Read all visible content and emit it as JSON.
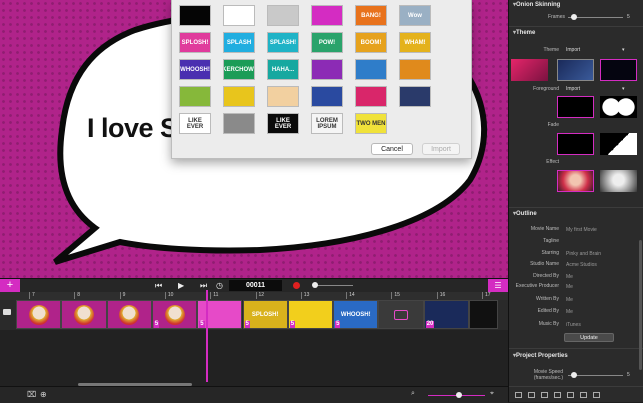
{
  "canvas": {
    "text": "I love S"
  },
  "dialog": {
    "tiles": [
      [
        {
          "bg": "#050505",
          "label": ""
        },
        {
          "bg": "#ffffff",
          "label": ""
        },
        {
          "bg": "#c9c9c9",
          "label": ""
        },
        {
          "bg": "#d42cc2",
          "label": ""
        },
        {
          "bg": "#e8721c",
          "label": "BANG!"
        },
        {
          "bg": "#9ab0c4",
          "label": "Wow"
        }
      ],
      [
        {
          "bg": "#e03b9c",
          "label": "SPLOSH!"
        },
        {
          "bg": "#21aee0",
          "label": "SPLASH"
        },
        {
          "bg": "#1fb3c6",
          "label": "SPLASH!"
        },
        {
          "bg": "#2aa36b",
          "label": "POW!"
        },
        {
          "bg": "#e6a21d",
          "label": "BOOM!"
        },
        {
          "bg": "#e4b21c",
          "label": "WHAM!"
        }
      ],
      [
        {
          "bg": "#4a2fb0",
          "label": "WHOOSH!"
        },
        {
          "bg": "#1b9c57",
          "label": "KERCHOW!"
        },
        {
          "bg": "#17a8a0",
          "label": "HAHA..."
        },
        {
          "bg": "#8c2bb5",
          "label": ""
        },
        {
          "bg": "#2f7dc9",
          "label": ""
        },
        {
          "bg": "#e08a1c",
          "label": ""
        }
      ],
      [
        {
          "bg": "#86b83a",
          "label": ""
        },
        {
          "bg": "#e8c51c",
          "label": ""
        },
        {
          "bg": "#f2d0a0",
          "label": ""
        },
        {
          "bg": "#2a4aa0",
          "label": ""
        },
        {
          "bg": "#d9266a",
          "label": ""
        },
        {
          "bg": "#2a3a6a",
          "label": ""
        }
      ],
      [
        {
          "bg": "#ffffff",
          "label": "LIKE EVER"
        },
        {
          "bg": "#8a8a8a",
          "label": ""
        },
        {
          "bg": "#0a0a0a",
          "label": "LIKE EVER"
        },
        {
          "bg": "#f5f5f5",
          "label": "LOREM IPSUM"
        },
        {
          "bg": "#f0e23a",
          "label": "TWO MEN"
        }
      ]
    ],
    "cancel_label": "Cancel",
    "import_label": "Import"
  },
  "transport": {
    "frame_counter": "00011",
    "add_label": "+"
  },
  "timeline": {
    "ruler_ticks": [
      "7",
      "8",
      "9",
      "10",
      "11",
      "12",
      "13",
      "14",
      "15",
      "16",
      "17"
    ],
    "clips": [
      {
        "type": "photo",
        "bg": "#b0238a",
        "label": "",
        "num": ""
      },
      {
        "type": "photo",
        "bg": "#b0238a",
        "label": "",
        "num": ""
      },
      {
        "type": "photo",
        "bg": "#b0238a",
        "label": "",
        "num": ""
      },
      {
        "type": "photo",
        "bg": "#b0238a",
        "label": "",
        "num": "5"
      },
      {
        "type": "title",
        "bg": "#e64ac8",
        "label": "",
        "num": "5"
      },
      {
        "type": "title",
        "bg": "#d9b21c",
        "label": "SPLOSH!",
        "num": "5"
      },
      {
        "type": "title",
        "bg": "#f2cf1c",
        "label": "",
        "num": "5"
      },
      {
        "type": "title",
        "bg": "#2a6ac4",
        "label": "WHOOSH!",
        "num": "5"
      },
      {
        "type": "camera",
        "bg": "#3a3a3a",
        "label": "",
        "num": ""
      },
      {
        "type": "title",
        "bg": "#1a2a5a",
        "label": "",
        "num": "20"
      },
      {
        "type": "empty",
        "bg": "#111111",
        "label": "",
        "num": ""
      }
    ]
  },
  "inspector": {
    "onion": {
      "title": "Onion Skinning",
      "frames_label": "Frames",
      "frames_value": "5",
      "frames_fraction": 0.1
    },
    "theme": {
      "title": "Theme",
      "theme_label": "Theme",
      "theme_value": "Import",
      "foreground_label": "Foreground",
      "foreground_value": "Import",
      "fade_label": "Fade",
      "effect_label": "Effect"
    },
    "outline": {
      "title": "Outline",
      "rows": [
        {
          "label": "Movie Name",
          "value": "My first Movie"
        },
        {
          "label": "Tagline",
          "value": ""
        },
        {
          "label": "Starring",
          "value": "Pinky and Brain"
        },
        {
          "label": "Studio Name",
          "value": "Acme Studios"
        },
        {
          "label": "Directed By",
          "value": "Me"
        },
        {
          "label": "Executive Producer",
          "value": "Me"
        },
        {
          "label": "Written By",
          "value": "Me"
        },
        {
          "label": "Edited By",
          "value": "Me"
        },
        {
          "label": "Music By",
          "value": "iTunes"
        }
      ],
      "update_label": "Update"
    },
    "project": {
      "title": "Project Properties",
      "speed_label": "Movie Speed (frames/sec.)",
      "speed_value": "5",
      "speed_fraction": 0.1
    }
  },
  "colors": {
    "accent": "#d42cc2",
    "stage": "#b0238a"
  }
}
